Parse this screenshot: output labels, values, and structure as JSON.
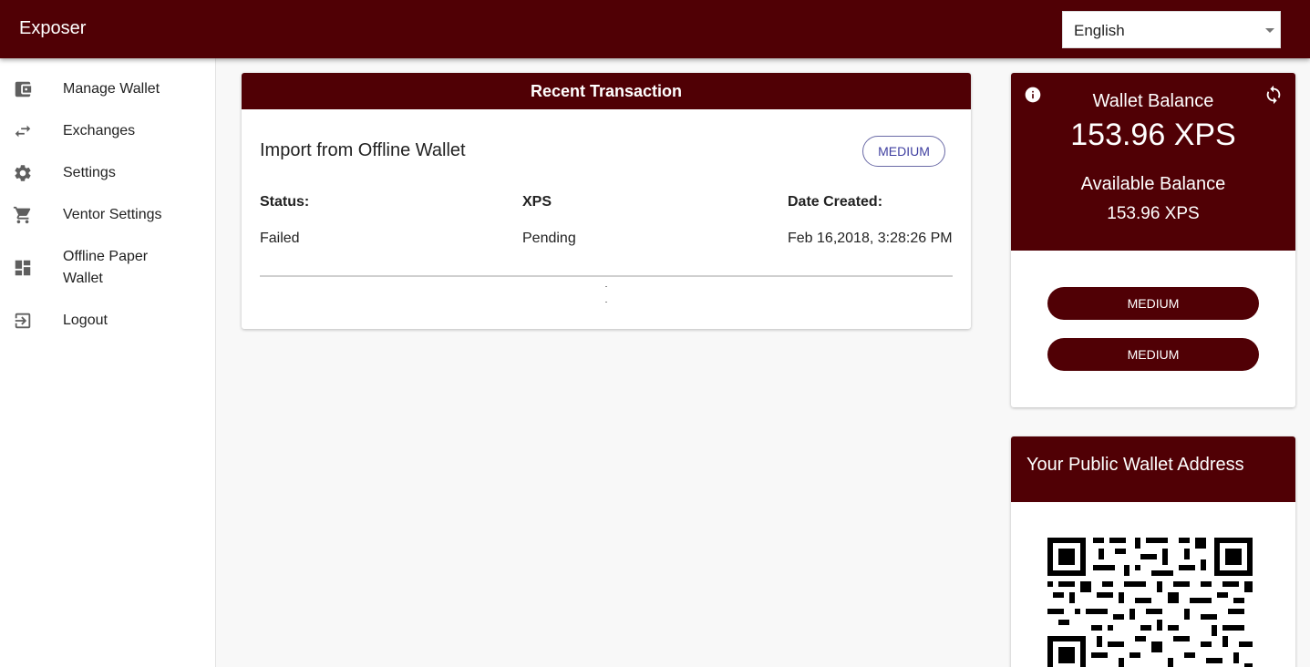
{
  "app": {
    "title": "Exposer"
  },
  "header": {
    "language": "English"
  },
  "sidebar": {
    "items": [
      {
        "label": "Manage Wallet",
        "icon": "wallet-icon"
      },
      {
        "label": "Exchanges",
        "icon": "swap-arrows-icon"
      },
      {
        "label": "Settings",
        "icon": "gear-icon"
      },
      {
        "label": "Ventor Settings",
        "icon": "cart-icon"
      },
      {
        "label": "Offline Paper",
        "label2": "Wallet",
        "icon": "dashboard-icon"
      },
      {
        "label": "Logout",
        "icon": "logout-icon"
      }
    ]
  },
  "transaction": {
    "header": "Recent Transaction",
    "title": "Import from Offline Wallet",
    "badge": "MEDIUM",
    "columns": {
      "status": "Status:",
      "currency": "XPS",
      "date": "Date Created:"
    },
    "values": {
      "status": "Failed",
      "currency": "Pending",
      "date": "Feb 16,2018, 3:28:26 PM"
    }
  },
  "balance": {
    "label": "Wallet Balance",
    "amount": "153.96 XPS",
    "available_label": "Available Balance",
    "available_amount": "153.96 XPS",
    "buttons": [
      "MEDIUM",
      "MEDIUM"
    ]
  },
  "address": {
    "title": "Your Public Wallet Address"
  },
  "colors": {
    "brand": "#500005",
    "outline_accent": "#3f3fa0"
  }
}
